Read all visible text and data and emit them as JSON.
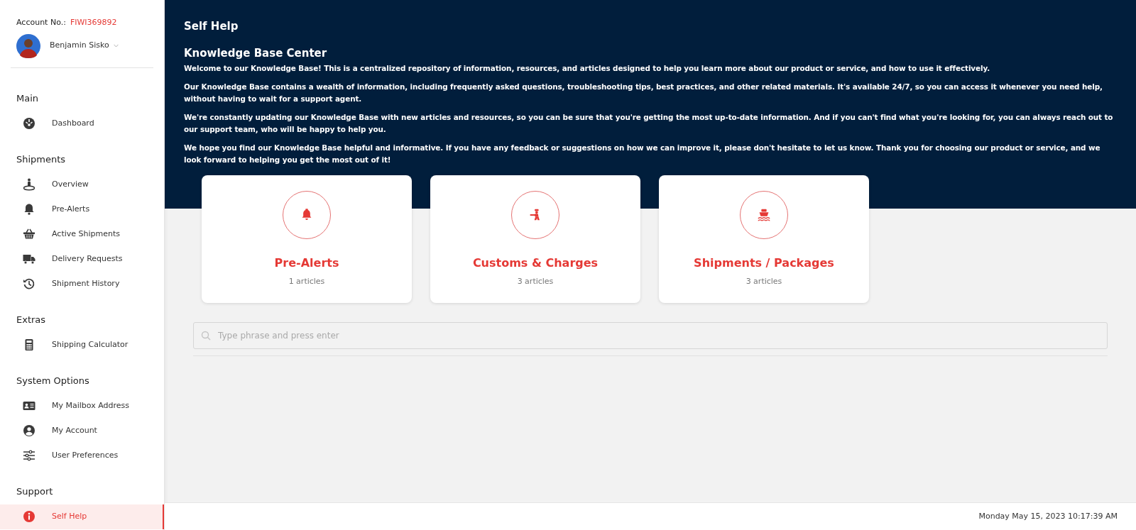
{
  "sidebar": {
    "account_label": "Account No.:",
    "account_number": "FIWI369892",
    "user_name": "Benjamin Sisko",
    "sections": [
      {
        "title": "Main",
        "items": [
          {
            "label": "Dashboard",
            "selected": false
          }
        ]
      },
      {
        "title": "Shipments",
        "items": [
          {
            "label": "Overview",
            "selected": false
          },
          {
            "label": "Pre-Alerts",
            "selected": false
          },
          {
            "label": "Active Shipments",
            "selected": false
          },
          {
            "label": "Delivery Requests",
            "selected": false
          },
          {
            "label": "Shipment History",
            "selected": false
          }
        ]
      },
      {
        "title": "Extras",
        "items": [
          {
            "label": "Shipping Calculator",
            "selected": false
          }
        ]
      },
      {
        "title": "System Options",
        "items": [
          {
            "label": "My Mailbox Address",
            "selected": false
          },
          {
            "label": "My Account",
            "selected": false
          },
          {
            "label": "User Preferences",
            "selected": false
          }
        ]
      },
      {
        "title": "Support",
        "items": [
          {
            "label": "Self Help",
            "selected": true
          }
        ]
      }
    ]
  },
  "main": {
    "title": "Self Help",
    "heading": "Knowledge Base Center",
    "paragraphs": [
      "Welcome to our Knowledge Base! This is a centralized repository of information, resources, and articles designed to help you learn more about our product or service, and how to use it effectively.",
      "Our Knowledge Base contains a wealth of information, including frequently asked questions, troubleshooting tips, best practices, and other related materials. It's available 24/7, so you can access it whenever you need help, without having to wait for a support agent.",
      "We're constantly updating our Knowledge Base with new articles and resources, so you can be sure that you're getting the most up-to-date information. And if you can't find what you're looking for, you can always reach out to our support team, who will be happy to help you.",
      "We hope you find our Knowledge Base helpful and informative. If you have any feedback or suggestions on how we can improve it, please don't hesitate to let us know. Thank you for choosing our product or service, and we look forward to helping you get the most out of it!"
    ],
    "categories": [
      {
        "title": "Pre-Alerts",
        "count": "1 articles"
      },
      {
        "title": "Customs & Charges",
        "count": "3 articles"
      },
      {
        "title": "Shipments / Packages",
        "count": "3 articles"
      }
    ],
    "search": {
      "placeholder": "Type phrase and press enter"
    }
  },
  "status_bar": {
    "datetime": "Monday May 15, 2023 10:17:39 AM"
  }
}
